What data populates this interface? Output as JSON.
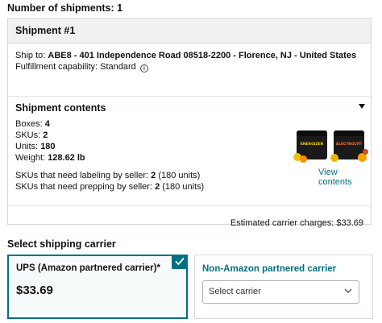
{
  "summary": {
    "shipments_label": "Number of shipments: 1"
  },
  "shipment": {
    "title": "Shipment #1",
    "ship_to_label": "Ship to:",
    "ship_to_address": "ABE8 - 401 Independence Road 08518-2200 - Florence, NJ - United States",
    "fulfillment_label": "Fulfillment capability: Standard",
    "info_icon": "info-icon"
  },
  "contents": {
    "title": "Shipment contents",
    "boxes_label": "Boxes:",
    "boxes_value": "4",
    "skus_label": "SKUs:",
    "skus_value": "2",
    "units_label": "Units:",
    "units_value": "180",
    "weight_label": "Weight:",
    "weight_value": "128.62 lb",
    "labeling_label": "SKUs that need labeling by seller:",
    "labeling_value": "2",
    "labeling_units": "(180 units)",
    "prepping_label": "SKUs that need prepping by seller:",
    "prepping_value": "2",
    "prepping_units": "(180 units)",
    "view_contents": "View contents",
    "expand_icon": "triangle-down-icon",
    "product_1_text": "ENERGIZER",
    "product_2_text": "ELECTROLYTES"
  },
  "charges": {
    "label": "Estimated carrier charges: $33.69"
  },
  "carrier": {
    "heading": "Select shipping carrier",
    "ups_name": "UPS (Amazon partnered carrier)*",
    "ups_price": "$33.69",
    "selected_icon": "checkmark-icon",
    "other_name": "Non-Amazon partnered carrier",
    "select_placeholder": "Select carrier",
    "select_icon": "chevron-down-icon"
  },
  "colors": {
    "accent": "#007185",
    "border": "#d5d9d9",
    "header_bg": "#f0f2f2"
  }
}
